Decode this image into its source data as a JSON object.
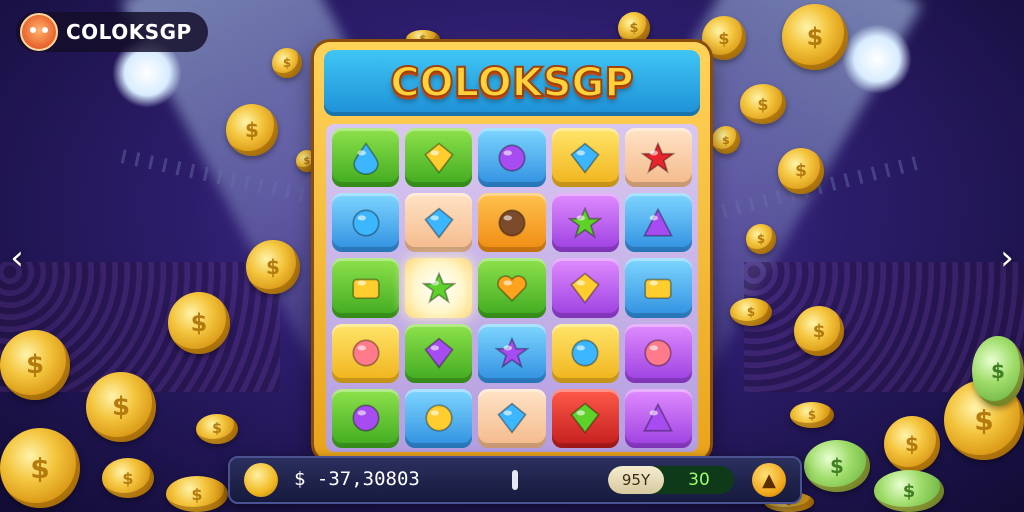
{
  "header": {
    "brand": "COLOKSGP"
  },
  "machine": {
    "title": "COLOKSGP"
  },
  "nav": {
    "prev_icon": "chevron-left-icon",
    "next_icon": "chevron-right-icon"
  },
  "grid": {
    "rows": [
      [
        {
          "color": "green",
          "icon": "water-drop-icon"
        },
        {
          "color": "green",
          "icon": "yellow-diamond-icon"
        },
        {
          "color": "blue",
          "icon": "purple-smiley-icon"
        },
        {
          "color": "yellow",
          "icon": "blue-blade-icon"
        },
        {
          "color": "peach",
          "icon": "red-star-icon"
        }
      ],
      [
        {
          "color": "blue",
          "icon": "blue-orb-icon"
        },
        {
          "color": "peach",
          "icon": "blue-gem-icon"
        },
        {
          "color": "orange",
          "icon": "spiral-shell-icon"
        },
        {
          "color": "purple",
          "icon": "green-star-icon"
        },
        {
          "color": "blue",
          "icon": "purple-rune-icon"
        }
      ],
      [
        {
          "color": "green",
          "icon": "gold-bar-icon"
        },
        {
          "color": "glow",
          "icon": "green-star-icon"
        },
        {
          "color": "green",
          "icon": "orange-heart-icon"
        },
        {
          "color": "purple",
          "icon": "gold-gem-icon"
        },
        {
          "color": "blue",
          "icon": "gold-block-icon"
        }
      ],
      [
        {
          "color": "yellow",
          "icon": "pink-face-icon"
        },
        {
          "color": "green",
          "icon": "purple-gem-icon"
        },
        {
          "color": "blue",
          "icon": "purple-star-icon"
        },
        {
          "color": "yellow",
          "icon": "blue-orb-icon"
        },
        {
          "color": "purple",
          "icon": "pink-face-icon"
        }
      ],
      [
        {
          "color": "green",
          "icon": "purple-orb-icon"
        },
        {
          "color": "blue",
          "icon": "gold-orb-icon"
        },
        {
          "color": "peach",
          "icon": "blue-gem-icon"
        },
        {
          "color": "red",
          "icon": "green-leaf-icon"
        },
        {
          "color": "purple",
          "icon": "purple-triangle-icon"
        }
      ]
    ]
  },
  "bottom_bar": {
    "balance": "$ -37,30803",
    "bet_label": "95Y",
    "bet_value": "30",
    "balance_icon": "coin-icon",
    "spin_icon": "spin-icon"
  },
  "colors": {
    "green": "#3fa91f",
    "blue": "#2f8fe0",
    "yellow": "#f0b21a",
    "purple": "#9b3fe0",
    "peach": "#f4b98b",
    "orange": "#f08b12",
    "red": "#c21d1d",
    "glow": "#fff6c9",
    "title_fill": "#ffd23c",
    "title_bar": "#1e8fd6"
  }
}
